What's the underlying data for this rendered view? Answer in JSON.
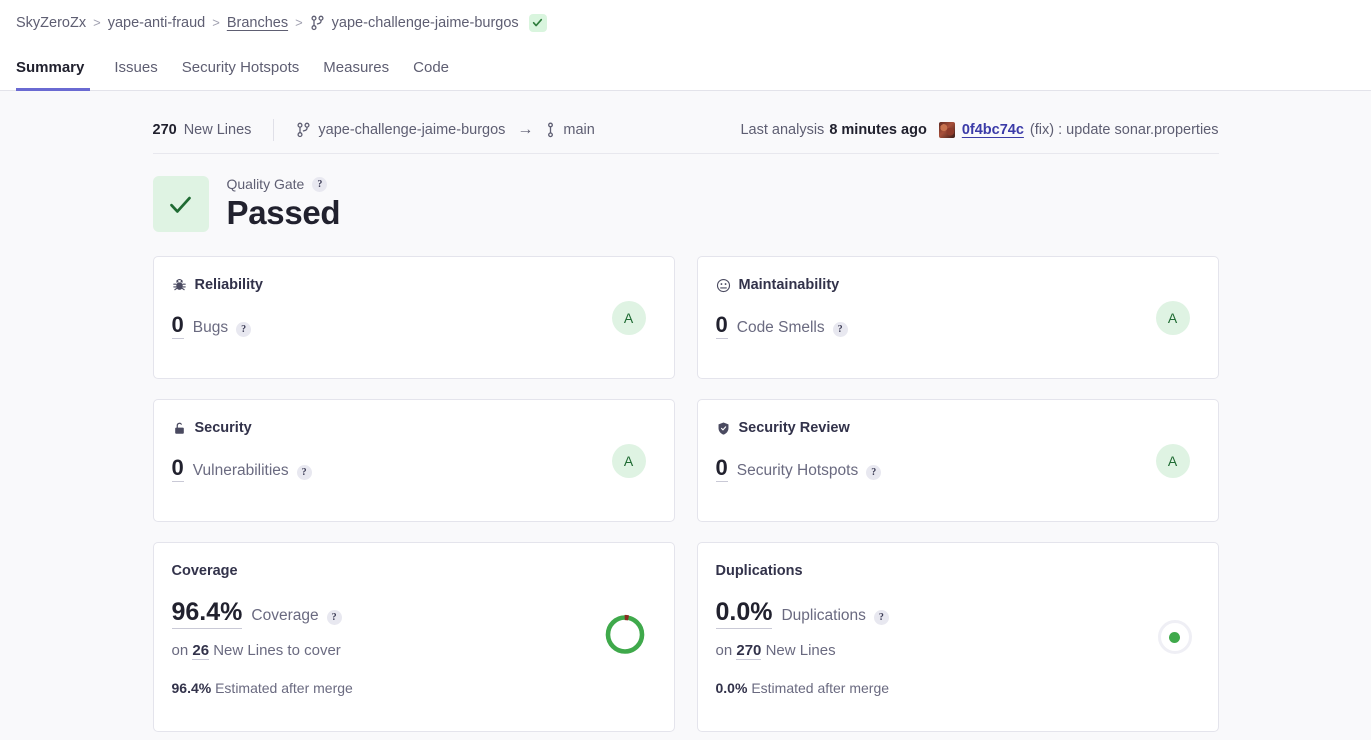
{
  "breadcrumb": {
    "org": "SkyZeroZx",
    "project": "yape-anti-fraud",
    "branches_link": "Branches",
    "branch": "yape-challenge-jaime-burgos",
    "sep": ">",
    "status_icon": "check-icon"
  },
  "tabs": [
    {
      "label": "Summary",
      "active": true
    },
    {
      "label": "Issues",
      "active": false
    },
    {
      "label": "Security Hotspots",
      "active": false
    },
    {
      "label": "Measures",
      "active": false
    },
    {
      "label": "Code",
      "active": false
    }
  ],
  "meta": {
    "new_lines_count": "270",
    "new_lines_label": "New Lines",
    "source_branch": "yape-challenge-jaime-burgos",
    "arrow": "→",
    "target_branch": "main",
    "last_analysis_label": "Last analysis",
    "last_analysis_time": "8 minutes ago",
    "commit_hash": "0f4bc74c",
    "commit_message": "(fix) : update sonar.properties"
  },
  "quality_gate": {
    "label": "Quality Gate",
    "status": "Passed",
    "help": "?"
  },
  "cards": [
    {
      "title": "Reliability",
      "icon": "bug-icon",
      "value": "0",
      "measure": "Bugs",
      "help": "?",
      "rating": "A"
    },
    {
      "title": "Maintainability",
      "icon": "code-smell-icon",
      "value": "0",
      "measure": "Code Smells",
      "help": "?",
      "rating": "A"
    },
    {
      "title": "Security",
      "icon": "lock-icon",
      "value": "0",
      "measure": "Vulnerabilities",
      "help": "?",
      "rating": "A"
    },
    {
      "title": "Security Review",
      "icon": "shield-icon",
      "value": "0",
      "measure": "Security Hotspots",
      "help": "?",
      "rating": "A"
    }
  ],
  "coverage": {
    "title": "Coverage",
    "value": "96.4%",
    "measure": "Coverage",
    "help": "?",
    "on_prefix": "on",
    "on_value": "26",
    "on_suffix": "New Lines to cover",
    "estimate_value": "96.4%",
    "estimate_label": "Estimated after merge",
    "donut_percent": 96.4,
    "donut_color": "#3FA94B",
    "donut_remainder_color": "#8A2B20"
  },
  "duplications": {
    "title": "Duplications",
    "value": "0.0%",
    "measure": "Duplications",
    "help": "?",
    "on_prefix": "on",
    "on_value": "270",
    "on_suffix": "New Lines",
    "estimate_value": "0.0%",
    "estimate_label": "Estimated after merge",
    "indicator_color": "#3FA94B"
  },
  "colors": {
    "accent": "#6A6AD2",
    "pass_green": "#DFF3E3",
    "pass_green_dark": "#1F6B33",
    "link": "#3B3BA8",
    "page_bg": "#F9F9FB"
  }
}
